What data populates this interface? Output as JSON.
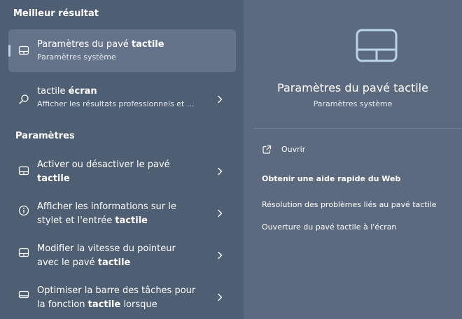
{
  "left": {
    "best_heading": "Meilleur résultat",
    "best": {
      "title_prefix": "Paramètres du pavé ",
      "title_bold": "tactile",
      "subtitle": "Paramètres système"
    },
    "web": {
      "title_prefix": "tactile ",
      "title_bold": "écran",
      "subtitle": "Afficher les résultats professionnels et ..."
    },
    "settings_heading": "Paramètres",
    "items": [
      {
        "line1": "Activer ou désactiver le pavé",
        "line2_prefix": "",
        "line2_bold": "tactile",
        "line2_suffix": ""
      },
      {
        "line1": "Afficher les informations sur le",
        "line2_prefix": "stylet et l'entrée ",
        "line2_bold": "tactile",
        "line2_suffix": ""
      },
      {
        "line1": "Modifier la vitesse du pointeur",
        "line2_prefix": "avec le pavé ",
        "line2_bold": "tactile",
        "line2_suffix": ""
      },
      {
        "line1": "Optimiser la barre des tâches pour",
        "line2_prefix": "la fonction ",
        "line2_bold": "tactile",
        "line2_suffix": " lorsque"
      }
    ]
  },
  "right": {
    "title": "Paramètres du pavé tactile",
    "subtitle": "Paramètres système",
    "open_label": "Ouvrir",
    "web_help_heading": "Obtenir une aide rapide du Web",
    "links": [
      "Résolution des problèmes liés au pavé tactile",
      "Ouverture du pavé tactile à l'écran"
    ]
  },
  "colors": {
    "left_bg": "#4f5f73",
    "right_bg": "#5b6a7f",
    "selected_bg": "#65738a",
    "accent": "#b8d4e6"
  },
  "icons": {
    "touchpad": "touchpad-icon",
    "search": "search-icon",
    "info": "info-icon",
    "taskbar": "taskbar-icon",
    "chevron": "chevron-right-icon",
    "open": "open-external-icon"
  }
}
